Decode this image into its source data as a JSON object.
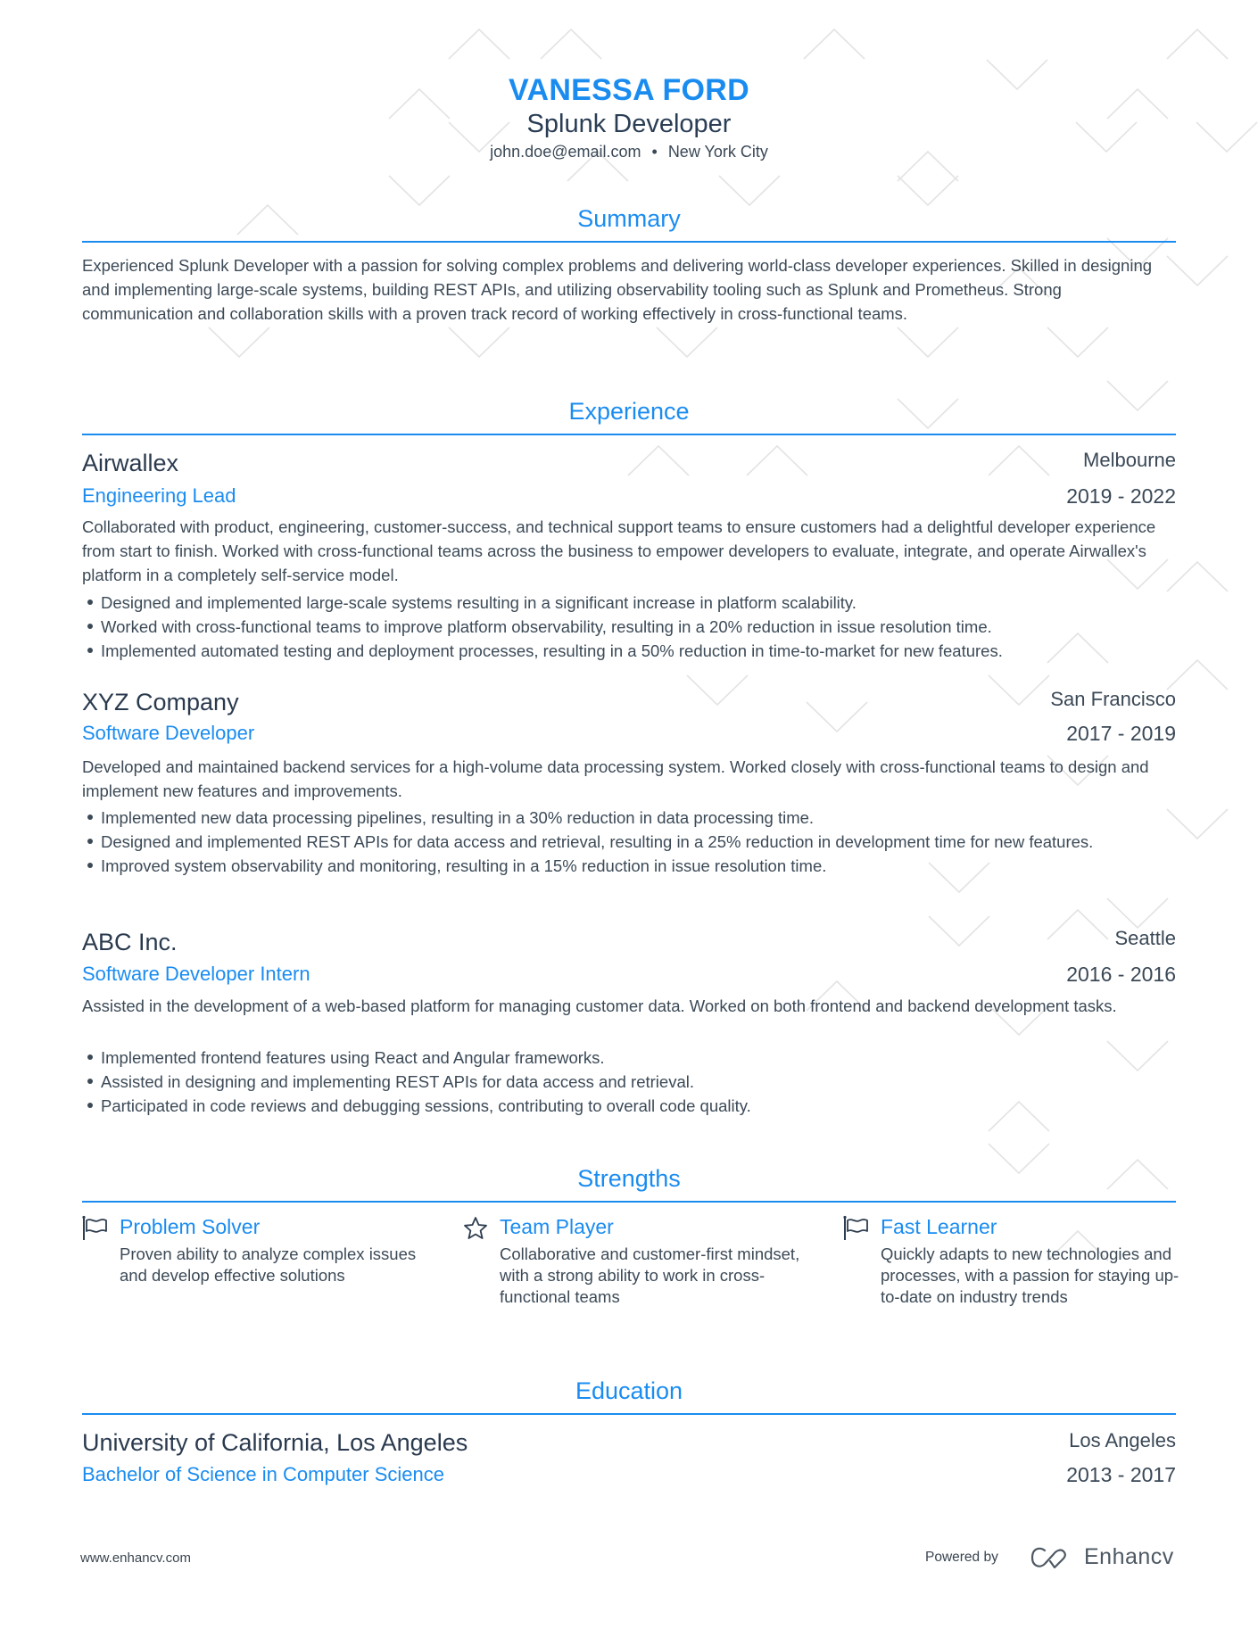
{
  "header": {
    "name": "VANESSA FORD",
    "title": "Splunk Developer",
    "email": "john.doe@email.com",
    "separator": "•",
    "location": "New York City"
  },
  "colors": {
    "accent": "#1a8cf0",
    "text_dark": "#2e3d4f",
    "text_body": "#3c4a57",
    "pattern": "#e3e3e3"
  },
  "summary": {
    "heading": "Summary",
    "text": "Experienced Splunk Developer with a passion for solving complex problems and delivering world-class developer experiences. Skilled in designing and implementing large-scale systems, building REST APIs, and utilizing observability tooling such as Splunk and Prometheus. Strong communication and collaboration skills with a proven track record of working effectively in cross-functional teams."
  },
  "experience": {
    "heading": "Experience",
    "jobs": [
      {
        "company": "Airwallex",
        "role": "Engineering Lead",
        "location": "Melbourne",
        "dates": "2019 - 2022",
        "description": "Collaborated with product, engineering, customer-success, and technical support teams to ensure customers had a delightful developer experience from start to finish. Worked with cross-functional teams across the business to empower developers to evaluate, integrate, and operate Airwallex's platform in a completely self-service model.",
        "bullets": [
          "Designed and implemented large-scale systems resulting in a significant increase in platform scalability.",
          "Worked with cross-functional teams to improve platform observability, resulting in a 20% reduction in issue resolution time.",
          "Implemented automated testing and deployment processes, resulting in a 50% reduction in time-to-market for new features."
        ]
      },
      {
        "company": "XYZ Company",
        "role": "Software Developer",
        "location": "San Francisco",
        "dates": "2017 - 2019",
        "description": "Developed and maintained backend services for a high-volume data processing system. Worked closely with cross-functional teams to design and implement new features and improvements.",
        "bullets": [
          "Implemented new data processing pipelines, resulting in a 30% reduction in data processing time.",
          "Designed and implemented REST APIs for data access and retrieval, resulting in a 25% reduction in development time for new features.",
          "Improved system observability and monitoring, resulting in a 15% reduction in issue resolution time."
        ]
      },
      {
        "company": "ABC Inc.",
        "role": "Software Developer Intern",
        "location": "Seattle",
        "dates": "2016 - 2016",
        "description": "Assisted in the development of a web-based platform for managing customer data. Worked on both frontend and backend development tasks.",
        "bullets": [
          "Implemented frontend features using React and Angular frameworks.",
          "Assisted in designing and implementing REST APIs for data access and retrieval.",
          "Participated in code reviews and debugging sessions, contributing to overall code quality."
        ]
      }
    ]
  },
  "strengths": {
    "heading": "Strengths",
    "items": [
      {
        "icon": "flag-icon",
        "title": "Problem Solver",
        "description": "Proven ability to analyze complex issues and develop effective solutions"
      },
      {
        "icon": "star-icon",
        "title": "Team Player",
        "description": "Collaborative and customer-first mindset, with a strong ability to work in cross-functional teams"
      },
      {
        "icon": "flag-icon",
        "title": "Fast Learner",
        "description": "Quickly adapts to new technologies and processes, with a passion for staying up-to-date on industry trends"
      }
    ]
  },
  "education": {
    "heading": "Education",
    "items": [
      {
        "school": "University of California, Los Angeles",
        "degree": "Bachelor of Science in Computer Science",
        "location": "Los Angeles",
        "dates": "2013 - 2017"
      }
    ]
  },
  "footer": {
    "url": "www.enhancv.com",
    "powered_by": "Powered by",
    "brand": "Enhancv",
    "logo_icon": "enhancv-logo-icon"
  }
}
